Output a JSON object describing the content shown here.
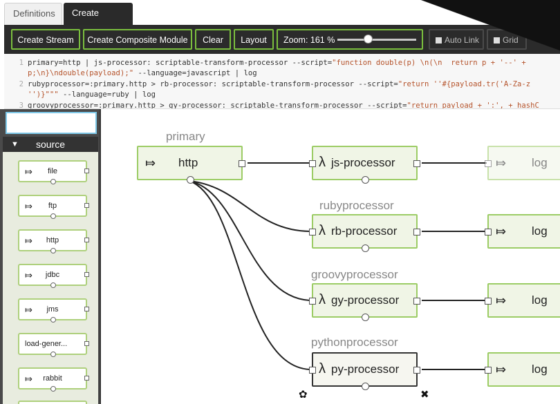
{
  "tabs": [
    {
      "label": "Definitions",
      "active": false
    },
    {
      "label": "Create Stream",
      "active": true
    }
  ],
  "toolbar": {
    "create_stream": "Create Stream",
    "create_composite": "Create Composite Module",
    "clear": "Clear",
    "layout": "Layout",
    "zoom_label": "Zoom: 161 %",
    "auto_link": "Auto Link",
    "grid": "Grid"
  },
  "editor": {
    "lines": [
      {
        "num": "1",
        "text": "primary=http | js-processor: scriptable-transform-processor --script=",
        "str": "\"function double(p) \\n(\\n  return p + '--' + ",
        "end": ""
      },
      {
        "num": "",
        "text": "",
        "str": "p;\\n}\\ndouble(payload);\"",
        "end": " --language=javascript | log"
      },
      {
        "num": "2",
        "text": "rubyprocessor=:primary.http > rb-processor: scriptable-transform-processor --script=",
        "str": "\"return ''#{payload.tr('A-Za-z",
        "end": ""
      },
      {
        "num": "",
        "text": "",
        "str": "'')}\"\"\"",
        "end": " --language=ruby | log"
      },
      {
        "num": "3",
        "text": "groovyprocessor=:primary.http > gy-processor: scriptable-transform-processor --script=",
        "str": "\"return payload + ':', + hashC",
        "end": ""
      }
    ]
  },
  "palette": {
    "category": "source",
    "modules": [
      "file",
      "ftp",
      "http",
      "jdbc",
      "jms",
      "load-gener...",
      "rabbit"
    ]
  },
  "canvas": {
    "groups": {
      "primary": "primary",
      "ruby": "rubyprocessor",
      "groovy": "groovyprocessor",
      "python": "pythonprocessor"
    },
    "nodes": {
      "http": "http",
      "js": "js-processor",
      "rb": "rb-processor",
      "gy": "gy-processor",
      "py": "py-processor",
      "log": "log"
    },
    "lambda": "λ",
    "arrow": "⤇",
    "gear": "✿",
    "close": "✖"
  },
  "colors": {
    "accent_green": "#9ccc65",
    "toolbar_bg": "#2b2b2b",
    "string": "#b5532b"
  }
}
